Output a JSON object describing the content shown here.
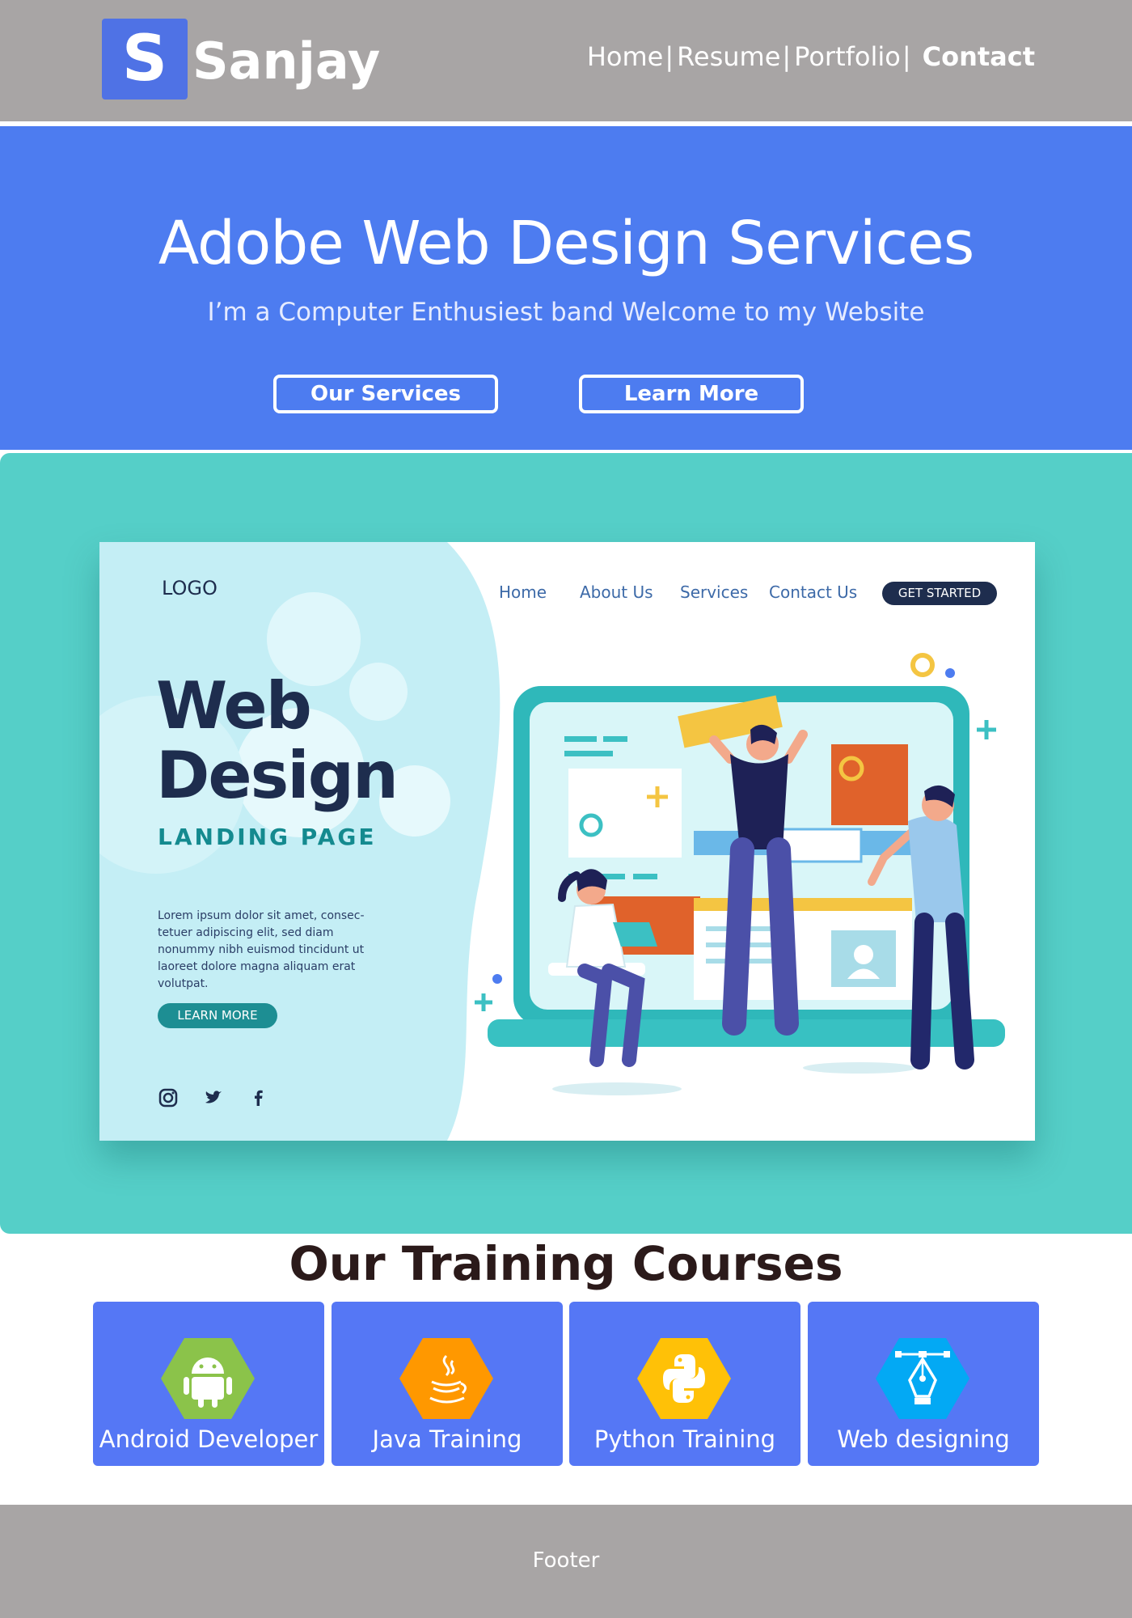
{
  "header": {
    "logo_letter": "S",
    "logo_name": "Sanjay",
    "nav": [
      "Home",
      "Resume",
      "Portfolio",
      "Contact"
    ],
    "nav_separator": "|"
  },
  "hero": {
    "title": "Adobe Web Design Services",
    "subtitle": "I’m a Computer Enthusiest band Welcome to my Website",
    "buttons": {
      "services": "Our Services",
      "learn_more": "Learn More"
    }
  },
  "illustration": {
    "logo": "LOGO",
    "nav": [
      "Home",
      "About Us",
      "Services",
      "Contact Us"
    ],
    "cta": "GET STARTED",
    "headline_1": "Web",
    "headline_2": "Design",
    "subheadline": "LANDING PAGE",
    "body": "Lorem ipsum dolor sit amet, consec- tetuer adipiscing elit, sed diam nonummy nibh euismod tincidunt ut laoreet dolore magna aliquam erat volutpat.",
    "learn_more": "LEARN MORE",
    "social_icons": [
      "instagram-icon",
      "twitter-icon",
      "facebook-icon"
    ]
  },
  "courses": {
    "title": "Our Training Courses",
    "items": [
      {
        "label": "Android Developer",
        "icon": "android-icon",
        "color": "#8bc34a"
      },
      {
        "label": "Java Training",
        "icon": "java-icon",
        "color": "#ff9800"
      },
      {
        "label": "Python Training",
        "icon": "python-icon",
        "color": "#ffc107"
      },
      {
        "label": "Web designing",
        "icon": "pen-tool-icon",
        "color": "#03a9f4"
      }
    ]
  },
  "footer": {
    "text": "Footer"
  },
  "colors": {
    "header_bg": "#a8a5a5",
    "hero_bg": "#4d7cf0",
    "showcase_bg": "#55cfc8",
    "course_card_bg": "#5577f5"
  }
}
